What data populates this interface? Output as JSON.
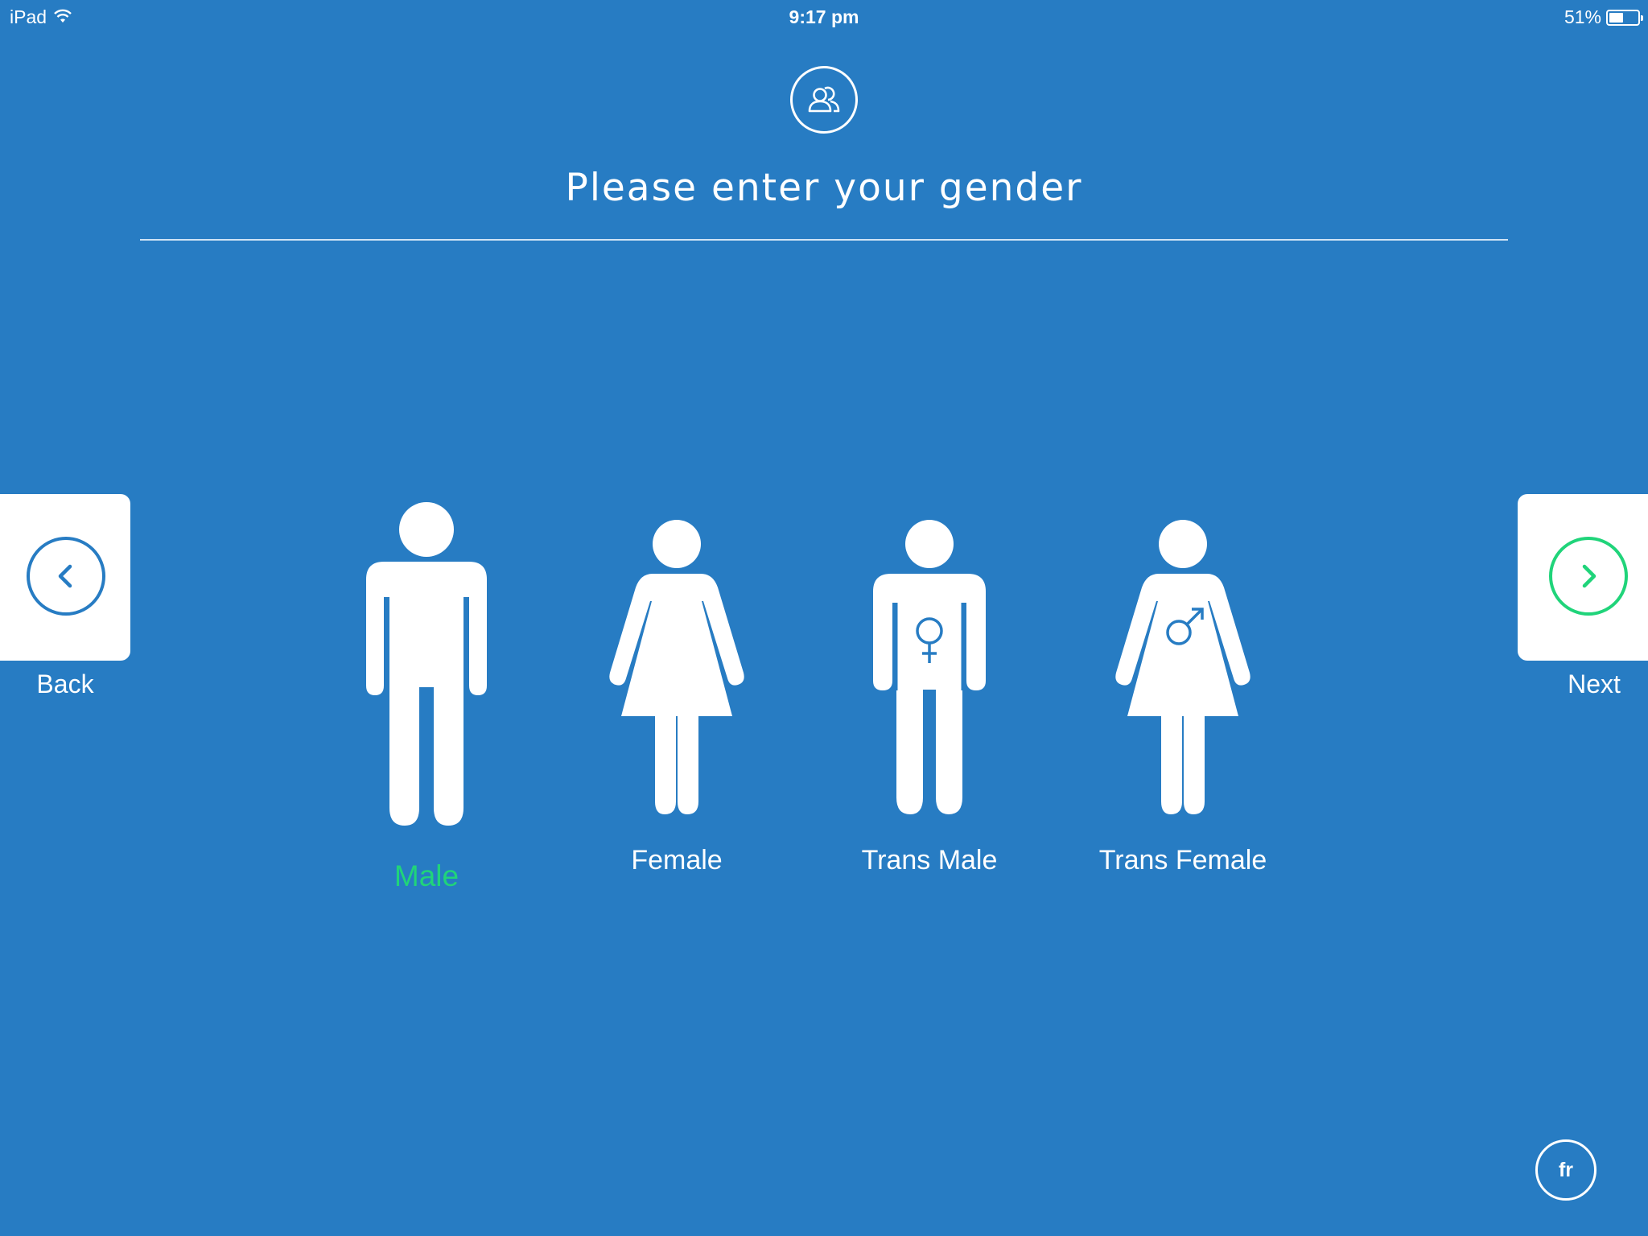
{
  "status_bar": {
    "device": "iPad",
    "time": "9:17 pm",
    "battery_percent": "51%",
    "battery_level": 0.51,
    "icons": [
      "wifi-icon",
      "battery-icon"
    ]
  },
  "header": {
    "icon": "people-icon",
    "title": "Please enter your gender"
  },
  "navigation": {
    "back_label": "Back",
    "next_label": "Next",
    "back_icon": "chevron-left-icon",
    "next_icon": "chevron-right-icon"
  },
  "options": [
    {
      "label": "Male",
      "icon": "male-figure-icon",
      "selected": true
    },
    {
      "label": "Female",
      "icon": "female-figure-icon",
      "selected": false
    },
    {
      "label": "Trans Male",
      "icon": "trans-male-figure-icon",
      "selected": false
    },
    {
      "label": "Trans Female",
      "icon": "trans-female-figure-icon",
      "selected": false
    }
  ],
  "language_button": {
    "label": "fr"
  },
  "colors": {
    "background": "#277cc3",
    "selected_accent": "#20d47a",
    "card": "#ffffff",
    "divider": "#cfe3f5"
  }
}
